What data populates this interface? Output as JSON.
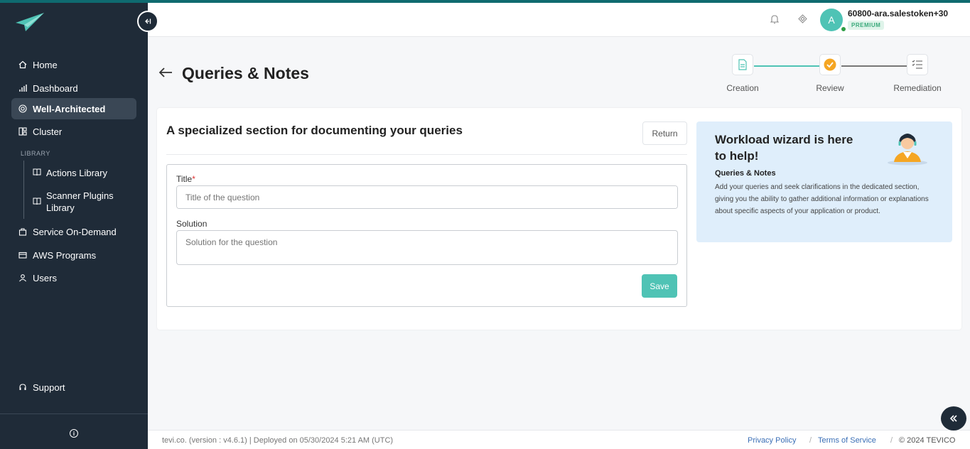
{
  "sidebar": {
    "collapse_icon": "collapse-left-icon",
    "items": [
      {
        "label": "Home",
        "icon": "home-icon"
      },
      {
        "label": "Dashboard",
        "icon": "bar-chart-icon"
      },
      {
        "label": "Well-Architected",
        "icon": "target-icon"
      },
      {
        "label": "Cluster",
        "icon": "layout-icon"
      },
      {
        "label": "Service On-Demand",
        "icon": "bag-icon"
      },
      {
        "label": "AWS Programs",
        "icon": "card-icon"
      },
      {
        "label": "Users",
        "icon": "user-icon"
      }
    ],
    "library_label": "LIBRARY",
    "library_items": [
      {
        "label": "Actions Library",
        "icon": "book-icon"
      },
      {
        "label": "Scanner Plugins Library",
        "icon": "book-icon"
      }
    ],
    "support_label": "Support",
    "active_color": "#3a4755",
    "bg_color": "#1f2b38"
  },
  "header": {
    "avatar_initial": "A",
    "username": "60800-ara.salestoken+30",
    "badge": "PREMIUM"
  },
  "page": {
    "title": "Queries & Notes",
    "steps": [
      {
        "label": "Creation",
        "icon": "document-icon",
        "state": "done"
      },
      {
        "label": "Review",
        "icon": "check-circle-icon",
        "state": "current"
      },
      {
        "label": "Remediation",
        "icon": "list-icon",
        "state": "pending"
      }
    ]
  },
  "section": {
    "title": "A specialized section for documenting your queries",
    "return_label": "Return",
    "title_label": "Title",
    "required_mark": "*",
    "title_placeholder": "Title of the question",
    "solution_label": "Solution",
    "solution_placeholder": "Solution for the question",
    "save_label": "Save",
    "accent_color": "#4fc3b5"
  },
  "help": {
    "title": "Workload wizard is here to help!",
    "subtitle": "Queries & Notes",
    "text": "Add your queries and seek clarifications in the dedicated section, giving you the ability to gather additional information or explanations about specific aspects of your application or product."
  },
  "footer": {
    "left": "tevi.co. (version : v4.6.1) | Deployed on 05/30/2024 5:21 AM (UTC)",
    "privacy": "Privacy Policy",
    "terms": "Terms of Service",
    "copyright": "© 2024 TEVICO"
  }
}
